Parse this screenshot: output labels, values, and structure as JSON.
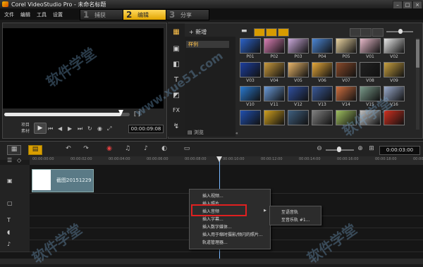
{
  "app": {
    "title": "Corel VideoStudio Pro - 未命名标题",
    "win_minimize": "–",
    "win_maximize": "□",
    "win_close": "×"
  },
  "menu": [
    "文件",
    "编辑",
    "工具",
    "设置"
  ],
  "steps": [
    {
      "num": "1",
      "label": "捕获",
      "active": false
    },
    {
      "num": "2",
      "label": "编辑",
      "active": true
    },
    {
      "num": "3",
      "label": "分享",
      "active": false
    }
  ],
  "player": {
    "project_label": "项目",
    "clip_label": "素材",
    "timecode": "00:00:09:08",
    "brackets": "[ ]"
  },
  "library": {
    "add_label": "新增",
    "folder": "样例",
    "browse_label": "浏览",
    "thumbs": [
      {
        "label": "P01",
        "color": "#2c63c9"
      },
      {
        "label": "P02",
        "color": "#d97fb4"
      },
      {
        "label": "P03",
        "color": "#c8a7d8"
      },
      {
        "label": "P04",
        "color": "#4b86d4"
      },
      {
        "label": "P05",
        "color": "#e8d2a0"
      },
      {
        "label": "V01",
        "color": "#e7b9c9"
      },
      {
        "label": "V02",
        "color": "#e8e8e8"
      },
      {
        "label": "V03",
        "color": "#1d3fa0"
      },
      {
        "label": "V04",
        "color": "#c99a3d"
      },
      {
        "label": "V05",
        "color": "#e8b56a"
      },
      {
        "label": "V06",
        "color": "#e6a83a"
      },
      {
        "label": "V07",
        "color": "#8a4a2a"
      },
      {
        "label": "V08",
        "color": "#222222"
      },
      {
        "label": "V09",
        "color": "#c8a040"
      },
      {
        "label": "V10",
        "color": "#2a7ad0"
      },
      {
        "label": "V11",
        "color": "#6a9ad8"
      },
      {
        "label": "V12",
        "color": "#3050a0"
      },
      {
        "label": "V13",
        "color": "#3a5a9a"
      },
      {
        "label": "V14",
        "color": "#d07040"
      },
      {
        "label": "V15",
        "color": "#7a9a8a"
      },
      {
        "label": "V16",
        "color": "#9aaacc"
      },
      {
        "label": "",
        "color": "#2050b0"
      },
      {
        "label": "",
        "color": "#d0a020"
      },
      {
        "label": "",
        "color": "#406080"
      },
      {
        "label": "",
        "color": "#808080"
      },
      {
        "label": "",
        "color": "#a0c060"
      },
      {
        "label": "",
        "color": "#c0c0c0"
      },
      {
        "label": "",
        "color": "#d03020"
      }
    ]
  },
  "timeline": {
    "timecode": "0:00:03:00",
    "ruler": [
      "00:00:00:00",
      "00:00:02:00",
      "00:00:04:00",
      "00:00:06:00",
      "00:00:08:00",
      "00:00:10:00",
      "00:00:12:00",
      "00:00:14:00",
      "00:00:16:00",
      "00:00:18:00",
      "00:00:20:00"
    ],
    "clip_name": "截图20151229"
  },
  "context_menu": {
    "items": [
      "插入视频...",
      "插入照片...",
      "插入音频",
      "插入字幕...",
      "插入数字媒体...",
      "插入用于缩时摄影/频闪的照片...",
      "轨道管理器..."
    ],
    "highlighted_index": 2,
    "submenu": [
      "至语音轨",
      "至音乐轨 #1..."
    ]
  },
  "watermark": [
    "软件学堂",
    "www.xue51.com"
  ]
}
